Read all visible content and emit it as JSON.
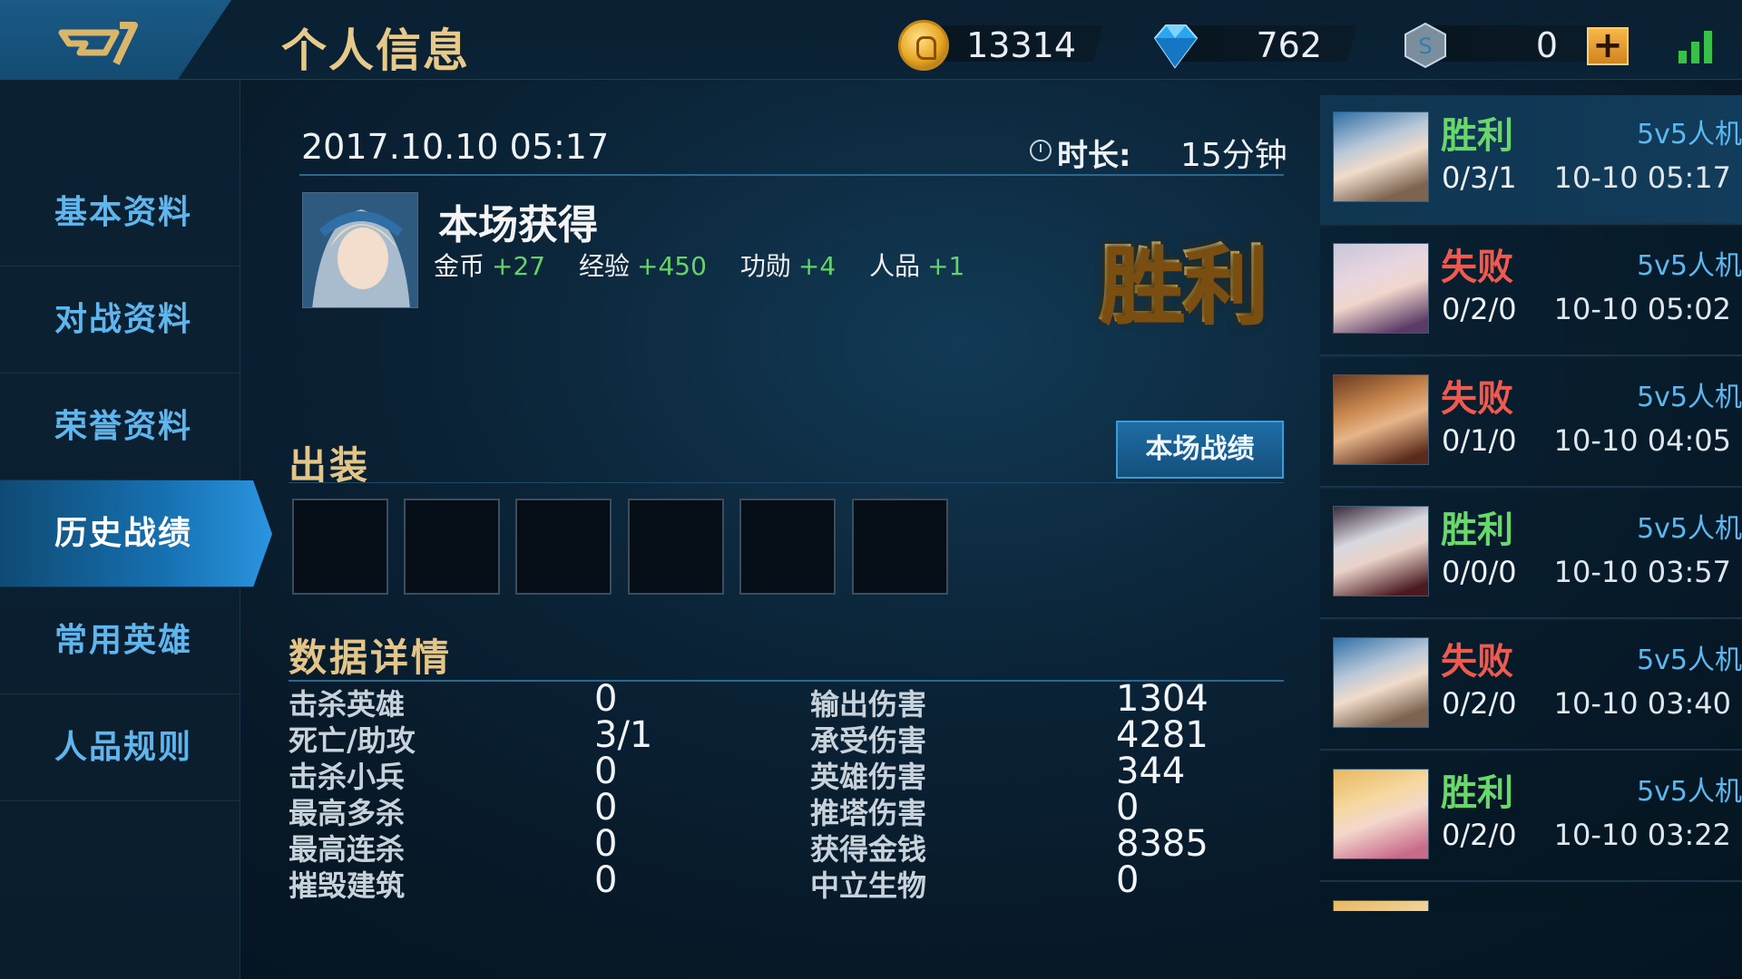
{
  "header": {
    "title": "个人信息",
    "currencies": {
      "gold": "13314",
      "diamond": "762",
      "voucher": "0"
    },
    "add_label": "+"
  },
  "nav": {
    "items": [
      {
        "label": "基本资料"
      },
      {
        "label": "对战资料"
      },
      {
        "label": "荣誉资料"
      },
      {
        "label": "历史战绩"
      },
      {
        "label": "常用英雄"
      },
      {
        "label": "人品规则"
      }
    ],
    "active_index": 3
  },
  "match": {
    "datetime": "2017.10.10 05:17",
    "duration_label": "时长:",
    "duration_value": "15分钟",
    "reward_title": "本场获得",
    "rewards": [
      {
        "label": "金币",
        "value": "+27"
      },
      {
        "label": "经验",
        "value": "+450"
      },
      {
        "label": "功勋",
        "value": "+4"
      },
      {
        "label": "人品",
        "value": "+1"
      }
    ],
    "result_banner": "胜利"
  },
  "equipment": {
    "title": "出装",
    "stats_button": "本场战绩",
    "slot_count": 6
  },
  "details": {
    "title": "数据详情",
    "left": [
      {
        "label": "击杀英雄",
        "value": "0"
      },
      {
        "label": "死亡/助攻",
        "value": "3/1"
      },
      {
        "label": "击杀小兵",
        "value": "0"
      },
      {
        "label": "最高多杀",
        "value": "0"
      },
      {
        "label": "最高连杀",
        "value": "0"
      },
      {
        "label": "摧毁建筑",
        "value": "0"
      }
    ],
    "right": [
      {
        "label": "输出伤害",
        "value": "1304"
      },
      {
        "label": "承受伤害",
        "value": "4281"
      },
      {
        "label": "英雄伤害",
        "value": "344"
      },
      {
        "label": "推塔伤害",
        "value": "0"
      },
      {
        "label": "获得金钱",
        "value": "8385"
      },
      {
        "label": "中立生物",
        "value": "0"
      }
    ]
  },
  "history": [
    {
      "result": "胜利",
      "win": true,
      "kda": "0/3/1",
      "mode": "5v5人机",
      "time": "10-10 05:17"
    },
    {
      "result": "失败",
      "win": false,
      "kda": "0/2/0",
      "mode": "5v5人机",
      "time": "10-10 05:02"
    },
    {
      "result": "失败",
      "win": false,
      "kda": "0/1/0",
      "mode": "5v5人机",
      "time": "10-10 04:05"
    },
    {
      "result": "胜利",
      "win": true,
      "kda": "0/0/0",
      "mode": "5v5人机",
      "time": "10-10 03:57"
    },
    {
      "result": "失败",
      "win": false,
      "kda": "0/2/0",
      "mode": "5v5人机",
      "time": "10-10 03:40"
    },
    {
      "result": "胜利",
      "win": true,
      "kda": "0/2/0",
      "mode": "5v5人机",
      "time": "10-10 03:22"
    }
  ],
  "colors": {
    "win": "#68d86a",
    "loss": "#f05a4e",
    "gold_text": "#e3c588",
    "nav_text": "#5fb6ef",
    "accent_blue": "#2b95e0"
  }
}
